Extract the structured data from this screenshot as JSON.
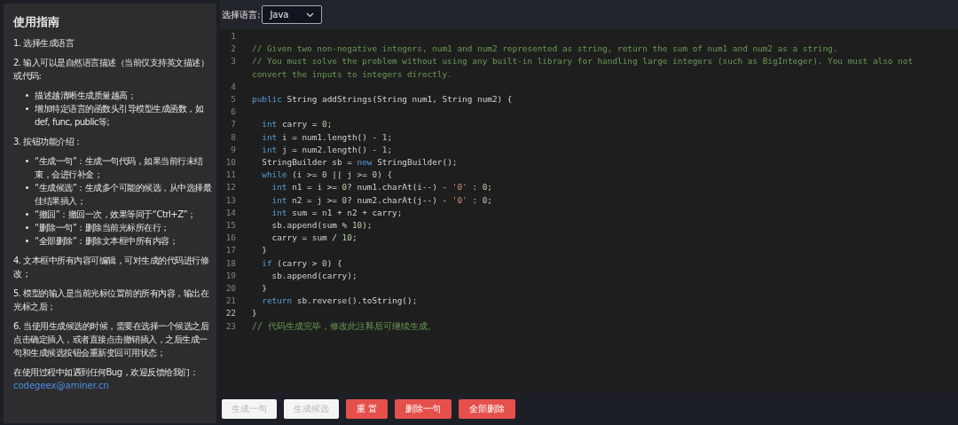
{
  "guide": {
    "title": "使用指南",
    "sections": [
      {
        "text": "1. 选择生成语言"
      },
      {
        "text": "2. 输入可以是自然语言描述（当前仅支持英文描述）或代码:",
        "bullets": [
          "描述越清晰生成质量越高；",
          "增加特定语言的函数头引导模型生成函数，如def, func, public等;"
        ]
      },
      {
        "text": "3. 按钮功能介绍：",
        "bullets": [
          "“生成一句”：生成一句代码，如果当前行未结束，会进行补全；",
          "“生成候选”：生成多个可能的候选，从中选择最佳结果插入；",
          "“撤回”：撤回一次，效果等同于“Ctrl+Z”；",
          "“删除一句”：删除当前光标所在行；",
          "“全部删除”：删除文本框中所有内容；"
        ]
      },
      {
        "text": "4. 文本框中所有内容可编辑，可对生成的代码进行修改；"
      },
      {
        "text": "5. 模型的输入是当前光标位置前的所有内容，输出在光标之后；"
      },
      {
        "text": "6. 当使用生成候选的时候，需要在选择一个候选之后点击确定插入，或者直接点击撤销插入，之后生成一句和生成候选按钮会重新变回可用状态；"
      }
    ],
    "contact": {
      "text": "在使用过程中如遇到任何Bug，欢迎反馈给我们：",
      "email": "codegeex@aminer.cn"
    }
  },
  "language": {
    "label": "选择语言:",
    "value": "Java"
  },
  "editor": {
    "lines": [
      {
        "number": "1",
        "current": false
      },
      {
        "number": "2",
        "current": false,
        "tokens": [
          {
            "kind": "comment",
            "text": "// Given two non-negative integers, num1 and num2 represented as string, return the sum of num1 and num2 as a string."
          }
        ]
      },
      {
        "number": "3",
        "current": false,
        "tokens": [
          {
            "kind": "comment",
            "text": "// You must solve the problem without using any built-in library for handling large integers (such as BigInteger). You must also not convert the inputs to integers directly."
          }
        ]
      },
      {
        "number": "4",
        "current": false
      },
      {
        "number": "5",
        "current": false,
        "tokens": [
          {
            "kind": "keyword",
            "text": "public"
          },
          {
            "kind": "plain",
            "text": " String addStrings(String num1, String num2) {"
          }
        ]
      },
      {
        "number": "6",
        "current": false
      },
      {
        "number": "7",
        "current": false,
        "tokens": [
          {
            "kind": "keyword",
            "text": "  int"
          },
          {
            "kind": "plain",
            "text": " carry = "
          },
          {
            "kind": "number",
            "text": "0"
          },
          {
            "kind": "plain",
            "text": ";"
          }
        ]
      },
      {
        "number": "8",
        "current": false,
        "tokens": [
          {
            "kind": "keyword",
            "text": "  int"
          },
          {
            "kind": "plain",
            "text": " i = num1.length() - "
          },
          {
            "kind": "number",
            "text": "1"
          },
          {
            "kind": "plain",
            "text": ";"
          }
        ]
      },
      {
        "number": "9",
        "current": false,
        "tokens": [
          {
            "kind": "keyword",
            "text": "  int"
          },
          {
            "kind": "plain",
            "text": " j = num2.length() - "
          },
          {
            "kind": "number",
            "text": "1"
          },
          {
            "kind": "plain",
            "text": ";"
          }
        ]
      },
      {
        "number": "10",
        "current": false,
        "tokens": [
          {
            "kind": "plain",
            "text": "  StringBuilder sb = "
          },
          {
            "kind": "keyword",
            "text": "new"
          },
          {
            "kind": "plain",
            "text": " StringBuilder();"
          }
        ]
      },
      {
        "number": "11",
        "current": false,
        "tokens": [
          {
            "kind": "keyword",
            "text": "  while"
          },
          {
            "kind": "plain",
            "text": " (i >= "
          },
          {
            "kind": "number",
            "text": "0"
          },
          {
            "kind": "plain",
            "text": " || j >= "
          },
          {
            "kind": "number",
            "text": "0"
          },
          {
            "kind": "plain",
            "text": ") {"
          }
        ]
      },
      {
        "number": "12",
        "current": false,
        "tokens": [
          {
            "kind": "keyword",
            "text": "    int"
          },
          {
            "kind": "plain",
            "text": " n1 = i >= "
          },
          {
            "kind": "number",
            "text": "0"
          },
          {
            "kind": "plain",
            "text": "? num1.charAt(i--) - "
          },
          {
            "kind": "string",
            "text": "'0'"
          },
          {
            "kind": "plain",
            "text": " : "
          },
          {
            "kind": "number",
            "text": "0"
          },
          {
            "kind": "plain",
            "text": ";"
          }
        ]
      },
      {
        "number": "13",
        "current": false,
        "tokens": [
          {
            "kind": "keyword",
            "text": "    int"
          },
          {
            "kind": "plain",
            "text": " n2 = j >= "
          },
          {
            "kind": "number",
            "text": "0"
          },
          {
            "kind": "plain",
            "text": "? num2.charAt(j--) - "
          },
          {
            "kind": "string",
            "text": "'0'"
          },
          {
            "kind": "plain",
            "text": " : "
          },
          {
            "kind": "number",
            "text": "0"
          },
          {
            "kind": "plain",
            "text": ";"
          }
        ]
      },
      {
        "number": "14",
        "current": false,
        "tokens": [
          {
            "kind": "keyword",
            "text": "    int"
          },
          {
            "kind": "plain",
            "text": " sum = n1 + n2 + carry;"
          }
        ]
      },
      {
        "number": "15",
        "current": false,
        "tokens": [
          {
            "kind": "plain",
            "text": "    sb.append(sum % "
          },
          {
            "kind": "number",
            "text": "10"
          },
          {
            "kind": "plain",
            "text": ");"
          }
        ]
      },
      {
        "number": "16",
        "current": false,
        "tokens": [
          {
            "kind": "plain",
            "text": "    carry = sum / "
          },
          {
            "kind": "number",
            "text": "10"
          },
          {
            "kind": "plain",
            "text": ";"
          }
        ]
      },
      {
        "number": "17",
        "current": false,
        "tokens": [
          {
            "kind": "plain",
            "text": "  }"
          }
        ]
      },
      {
        "number": "18",
        "current": false,
        "tokens": [
          {
            "kind": "keyword",
            "text": "  if"
          },
          {
            "kind": "plain",
            "text": " (carry > "
          },
          {
            "kind": "number",
            "text": "0"
          },
          {
            "kind": "plain",
            "text": ") {"
          }
        ]
      },
      {
        "number": "19",
        "current": false,
        "tokens": [
          {
            "kind": "plain",
            "text": "    sb.append(carry);"
          }
        ]
      },
      {
        "number": "20",
        "current": false,
        "tokens": [
          {
            "kind": "plain",
            "text": "  }"
          }
        ]
      },
      {
        "number": "21",
        "current": false,
        "tokens": [
          {
            "kind": "keyword",
            "text": "  return"
          },
          {
            "kind": "plain",
            "text": " sb.reverse().toString();"
          }
        ]
      },
      {
        "number": "22",
        "current": true,
        "tokens": [
          {
            "kind": "plain",
            "text": "}"
          }
        ]
      },
      {
        "number": "23",
        "current": false,
        "tokens": [
          {
            "kind": "comment",
            "text": "// 代码生成完毕，修改此注释后可继续生成。"
          }
        ]
      }
    ]
  },
  "buttons": [
    {
      "label": "生成一句",
      "disabled": true,
      "kind": "default"
    },
    {
      "label": "生成候选",
      "disabled": true,
      "kind": "default"
    },
    {
      "label": "重 置",
      "disabled": false,
      "kind": "danger"
    },
    {
      "label": "删除一句",
      "disabled": false,
      "kind": "danger"
    },
    {
      "label": "全部删除",
      "disabled": false,
      "kind": "danger"
    }
  ]
}
